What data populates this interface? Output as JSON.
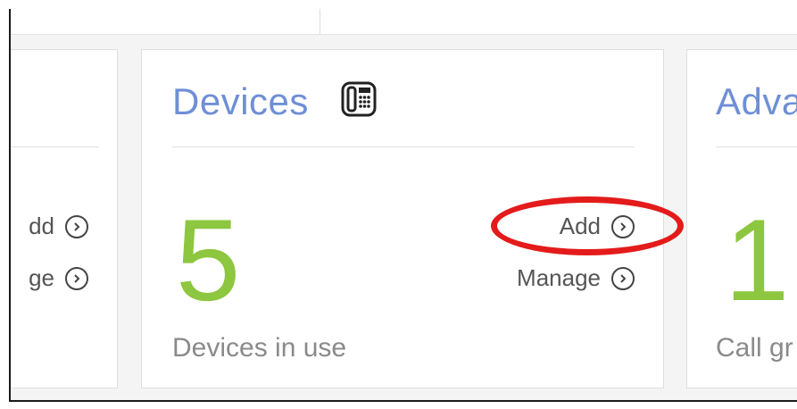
{
  "cards": {
    "left": {
      "links": [
        {
          "label": "dd"
        },
        {
          "label": "ge"
        }
      ]
    },
    "devices": {
      "title": "Devices",
      "count": "5",
      "count_label": "Devices in use",
      "links": [
        {
          "label": "Add"
        },
        {
          "label": "Manage"
        }
      ],
      "icon": "desk-phone-icon"
    },
    "right": {
      "title": "Adva",
      "count": "1",
      "count_label": "Call gr"
    }
  },
  "colors": {
    "title": "#6f8fd6",
    "count": "#8dc63f",
    "highlight": "#e41b1b"
  }
}
